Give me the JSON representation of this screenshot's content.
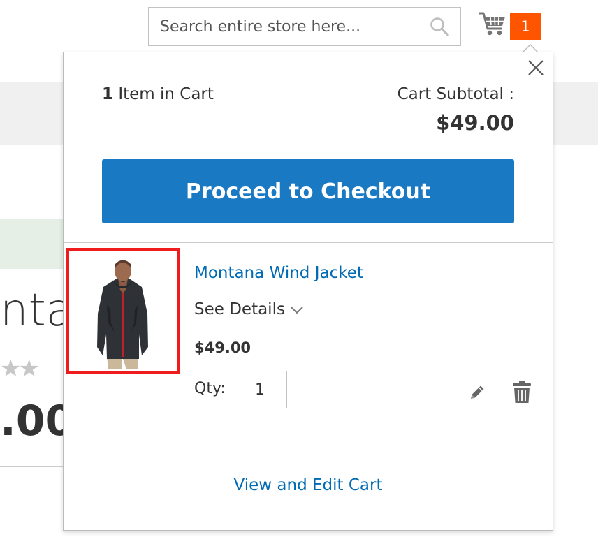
{
  "background": {
    "title_fragment": "nta",
    "stars": "★★",
    "price_fragment": ".00"
  },
  "header": {
    "search": {
      "placeholder": "Search entire store here...",
      "value": "",
      "icon": "search-icon"
    },
    "cart": {
      "icon": "shopping-cart-icon",
      "count": "1",
      "badge_color": "#ff5501"
    }
  },
  "minicart": {
    "close_icon": "close-icon",
    "items_count": "1",
    "items_label": "Item in Cart",
    "subtotal_label": "Cart Subtotal :",
    "subtotal_value": "$49.00",
    "checkout_label": "Proceed to Checkout",
    "checkout_color": "#1979c3",
    "item": {
      "name": "Montana Wind Jacket",
      "details_label": "See Details",
      "price": "$49.00",
      "qty_label": "Qty:",
      "qty_value": "1",
      "edit_icon": "pencil-icon",
      "remove_icon": "trash-icon",
      "highlight_color": "#ee1c1c"
    },
    "view_cart_label": "View and Edit Cart",
    "link_color": "#006bb4"
  }
}
